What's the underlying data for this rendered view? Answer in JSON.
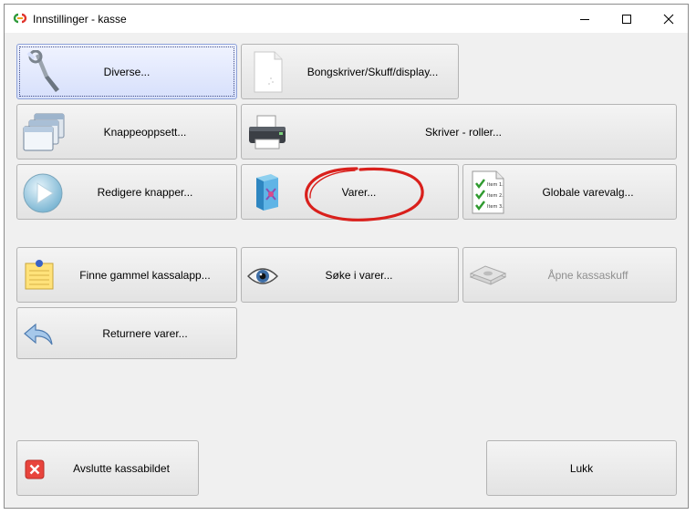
{
  "window": {
    "title": "Innstillinger - kasse",
    "controls": [
      "minimize-icon",
      "maximize-icon",
      "close-icon"
    ]
  },
  "buttons": {
    "diverse": "Diverse...",
    "bongskriver": "Bongskriver/Skuff/display...",
    "knappeoppsett": "Knappeoppsett...",
    "skriver_roller": "Skriver - roller...",
    "redigere_knapper": "Redigere knapper...",
    "varer": "Varer...",
    "globale_varevalg": "Globale varevalg...",
    "finne_kassalapp": "Finne gammel kassalapp...",
    "soke_varer": "Søke i varer...",
    "apne_kassaskuff": "Åpne kassaskuff",
    "returnere_varer": "Returnere varer...",
    "avslutte": "Avslutte kassabildet",
    "lukk": "Lukk"
  },
  "checklist_items": [
    "Item 1.",
    "Item 2.",
    "Item 3."
  ],
  "colors": {
    "annotation": "#d9201c",
    "close_red": "#e8443c",
    "selected_bg": "#d7e0fb"
  },
  "icons": {
    "diverse": "wrench-icon",
    "bongskriver": "document-icon",
    "knappeoppsett": "windows-icon",
    "skriver_roller": "printer-icon",
    "redigere_knapper": "play-icon",
    "varer": "product-box-icon",
    "globale_varevalg": "checklist-icon",
    "finne_kassalapp": "notepad-icon",
    "soke_varer": "eye-icon",
    "apne_kassaskuff": "money-stack-icon",
    "returnere_varer": "back-arrow-icon",
    "avslutte": "close-red-icon"
  },
  "state": {
    "selected_button": "Diverse...",
    "disabled_buttons": [
      "Åpne kassaskuff"
    ]
  }
}
